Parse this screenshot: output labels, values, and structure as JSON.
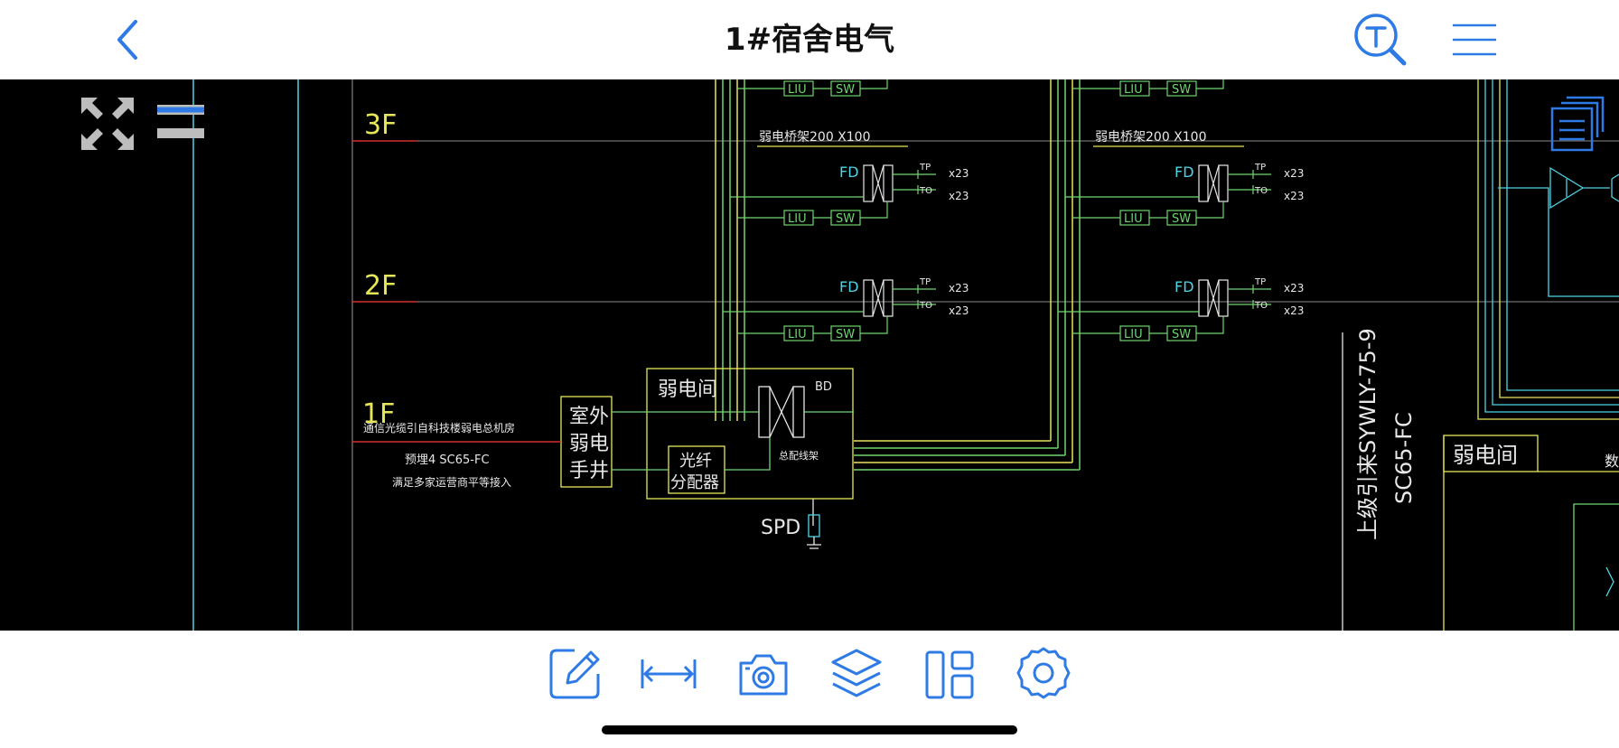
{
  "header": {
    "title": "1#宿舍电气",
    "back_icon": "chevron-left-icon",
    "search_icon": "text-search-icon",
    "menu_icon": "menu-lines-icon"
  },
  "canvas_tools": {
    "fullscreen_icon": "expand-arrows-icon",
    "layout_icon": "split-lines-icon",
    "doc_list_icon": "stacked-documents-icon"
  },
  "drawing": {
    "floors": [
      "3F",
      "2F",
      "1F"
    ],
    "tray_label_left": "弱电桥架200 X100",
    "tray_label_right": "弱电桥架200 X100",
    "device_fd": "FD",
    "device_liu": "LIU",
    "device_sw": "SW",
    "port_tp": "TP",
    "port_to": "TO",
    "port_count": "x23",
    "room_label": "弱电间",
    "bd_label": "BD",
    "bd_sub_label": "总配线架",
    "outdoor_well_label": [
      "室外",
      "弱电",
      "手井"
    ],
    "splitter_label": [
      "光纤",
      "分配器"
    ],
    "spd_label": "SPD",
    "incoming_note_1": "通信光缆引自科技楼弱电总机房",
    "incoming_note_2": "预埋4 SC65-FC",
    "incoming_note_3": "满足多家运营商平等接入",
    "upstream_cable": "上级引来SYWLY-75-9",
    "upstream_conduit": "SC65-FC",
    "room_label_right": "弱电间",
    "cut_text_right": "数"
  },
  "toolbar": {
    "items": [
      {
        "name": "annotate-edit-icon"
      },
      {
        "name": "measure-distance-icon"
      },
      {
        "name": "camera-icon"
      },
      {
        "name": "layers-icon"
      },
      {
        "name": "layout-panels-icon"
      },
      {
        "name": "settings-gear-icon"
      }
    ]
  },
  "colors": {
    "accent": "#2f7be5",
    "cad_background": "#000000",
    "cad_green": "#6fd66f",
    "cad_yellow": "#e6e65a",
    "cad_cyan": "#4fd3e6",
    "cad_red": "#d23030",
    "cad_white": "#e8e8e8",
    "cad_gray_line": "#7a7a7a"
  }
}
